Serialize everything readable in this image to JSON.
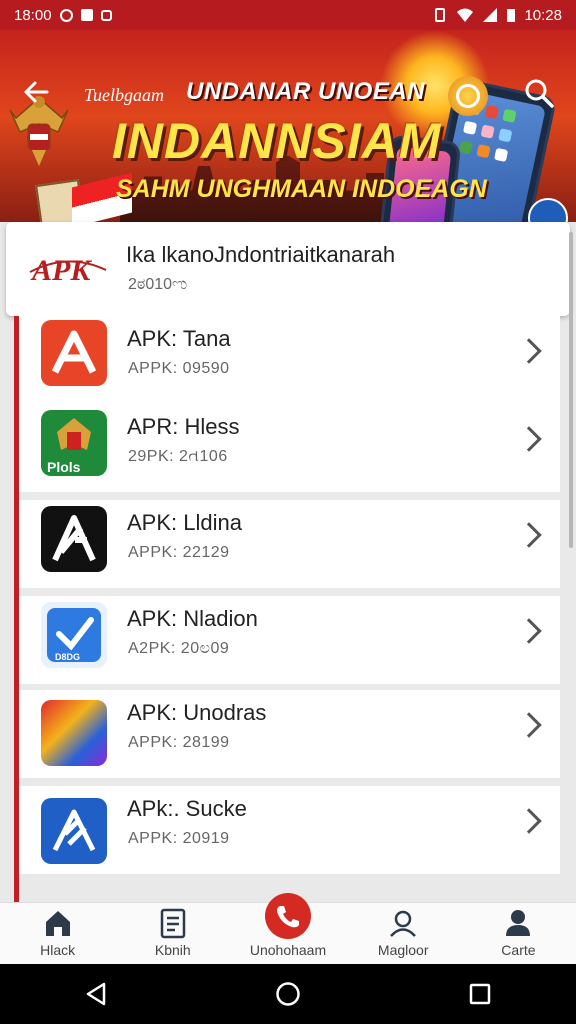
{
  "status_bar": {
    "time_left": "18:00",
    "time_right": "10:28"
  },
  "banner": {
    "small_text": "Tuelbgaam",
    "line1": "UNDANAR UNOEAN",
    "line2": "INDANNSIAM",
    "line3": "SAHM UNGHMAAN INDOEAGN"
  },
  "header_card": {
    "title": "Ika lkanoJndontriaitkanarah",
    "subtitle": "2ಠ010ಌ",
    "logo_text": "APK"
  },
  "apps": [
    {
      "title": "APK: Tana",
      "subtitle": "APPK: 09590",
      "icon": "apk-a-red-icon"
    },
    {
      "title": "APR: Hless",
      "subtitle": "29PK: 2ત106",
      "icon": "garuda-green-icon",
      "icon_text": "Plols"
    },
    {
      "title": "APK: Lldina",
      "subtitle": "APPK: 22129",
      "icon": "a-black-icon"
    },
    {
      "title": "APK: Nladion",
      "subtitle": "A2PK: 20ಲ09",
      "icon": "checkmark-blue-icon",
      "icon_text": "D8DG"
    },
    {
      "title": "APK: Unodras",
      "subtitle": "APPK: 28199",
      "icon": "colorful-game-icon"
    },
    {
      "title": "APk:. Sucke",
      "subtitle": "APPK: 20919",
      "icon": "a-blue-icon"
    }
  ],
  "bottom_nav": [
    {
      "label": "Hlack",
      "icon": "home-icon"
    },
    {
      "label": "Kbnih",
      "icon": "document-icon"
    },
    {
      "label": "Unohohaam",
      "icon": "phone-call-icon",
      "active": true
    },
    {
      "label": "Magloor",
      "icon": "user-outline-icon"
    },
    {
      "label": "Carte",
      "icon": "user-icon"
    }
  ],
  "colors": {
    "brand_red": "#b61b1f",
    "accent_yellow": "#ffe44a",
    "list_rail": "#c21f24"
  }
}
